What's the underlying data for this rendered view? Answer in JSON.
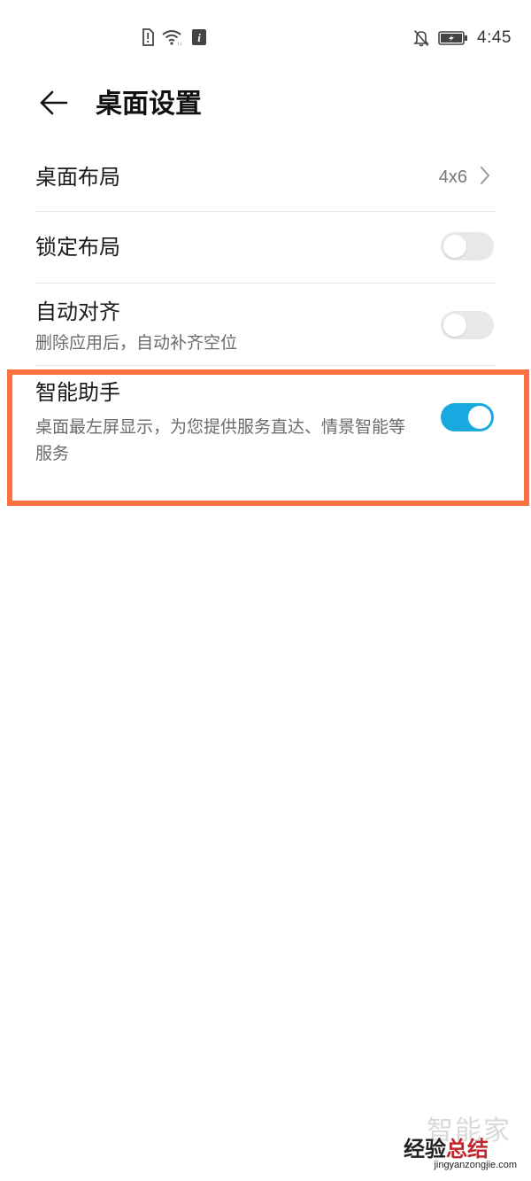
{
  "status_bar": {
    "time": "4:45",
    "icons_left": [
      "sim-alert-icon",
      "wifi-icon",
      "info-icon"
    ],
    "icons_right": [
      "bell-off-icon",
      "battery-icon"
    ]
  },
  "header": {
    "title": "桌面设置",
    "back_icon": "arrow-left-icon"
  },
  "settings": {
    "layout": {
      "title": "桌面布局",
      "value": "4x6"
    },
    "lock_layout": {
      "title": "锁定布局",
      "enabled": false
    },
    "auto_align": {
      "title": "自动对齐",
      "subtitle": "删除应用后，自动补齐空位",
      "enabled": false
    },
    "smart_assistant": {
      "title": "智能助手",
      "subtitle": "桌面最左屏显示，为您提供服务直达、情景智能等服务",
      "enabled": true
    }
  },
  "highlight": {
    "color": "#ff7040"
  },
  "colors": {
    "toggle_on": "#1aa8e0",
    "toggle_off": "#e8e8e8"
  },
  "watermark": {
    "faint": "智能家",
    "main_prefix": "经验",
    "main_accent": "总结",
    "url": "jingyanzongjie.com"
  }
}
